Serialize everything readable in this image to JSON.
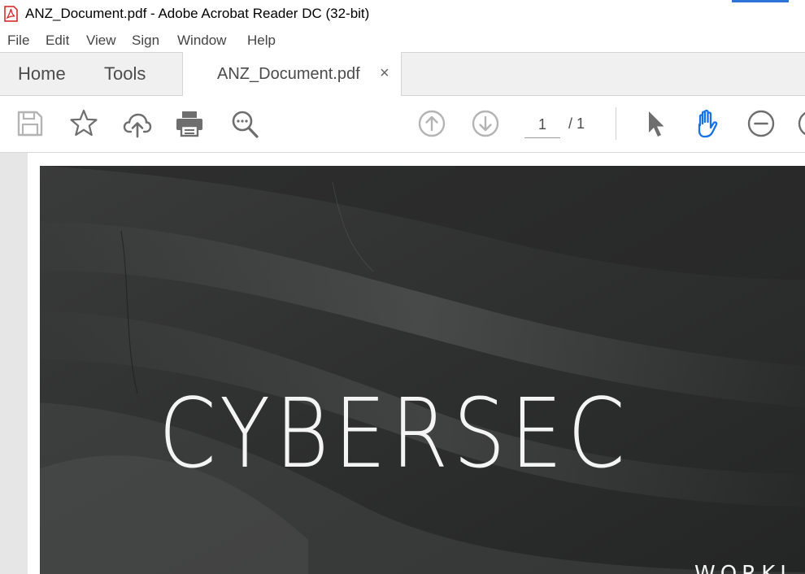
{
  "window": {
    "title": "ANZ_Document.pdf - Adobe Acrobat Reader DC (32-bit)",
    "app_icon": "acrobat-pdf-icon"
  },
  "menu": {
    "items": [
      "File",
      "Edit",
      "View",
      "Sign",
      "Window",
      "Help"
    ]
  },
  "tabs": {
    "home": "Home",
    "tools": "Tools",
    "document": "ANZ_Document.pdf",
    "close_glyph": "×"
  },
  "toolbar": {
    "icons": [
      "save-icon",
      "star-icon",
      "cloud-upload-icon",
      "print-icon",
      "search-icon",
      "page-up-icon",
      "page-down-icon",
      "select-arrow-icon",
      "hand-tool-icon",
      "zoom-out-icon"
    ],
    "current_page": "1",
    "page_total": "/ 1"
  },
  "document": {
    "cover_title": "CYBERSEC",
    "cover_subtitle": "WORKI"
  },
  "colors": {
    "active_tool": "#1473e6",
    "icon_gray": "#6e6e6e",
    "icon_disabled": "#b4b4b4",
    "cover_bg": "#2b2c2c"
  }
}
